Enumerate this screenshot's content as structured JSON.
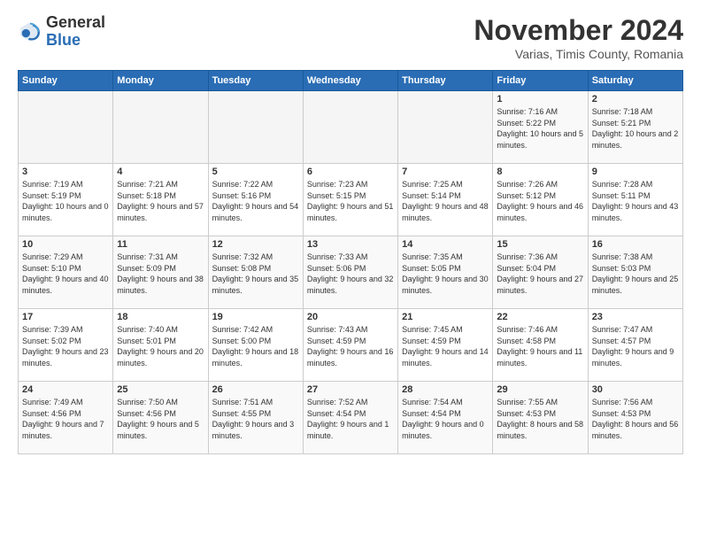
{
  "header": {
    "logo_line1": "General",
    "logo_line2": "Blue",
    "month": "November 2024",
    "location": "Varias, Timis County, Romania"
  },
  "weekdays": [
    "Sunday",
    "Monday",
    "Tuesday",
    "Wednesday",
    "Thursday",
    "Friday",
    "Saturday"
  ],
  "weeks": [
    [
      {
        "day": "",
        "info": ""
      },
      {
        "day": "",
        "info": ""
      },
      {
        "day": "",
        "info": ""
      },
      {
        "day": "",
        "info": ""
      },
      {
        "day": "",
        "info": ""
      },
      {
        "day": "1",
        "info": "Sunrise: 7:16 AM\nSunset: 5:22 PM\nDaylight: 10 hours\nand 5 minutes."
      },
      {
        "day": "2",
        "info": "Sunrise: 7:18 AM\nSunset: 5:21 PM\nDaylight: 10 hours\nand 2 minutes."
      }
    ],
    [
      {
        "day": "3",
        "info": "Sunrise: 7:19 AM\nSunset: 5:19 PM\nDaylight: 10 hours\nand 0 minutes."
      },
      {
        "day": "4",
        "info": "Sunrise: 7:21 AM\nSunset: 5:18 PM\nDaylight: 9 hours\nand 57 minutes."
      },
      {
        "day": "5",
        "info": "Sunrise: 7:22 AM\nSunset: 5:16 PM\nDaylight: 9 hours\nand 54 minutes."
      },
      {
        "day": "6",
        "info": "Sunrise: 7:23 AM\nSunset: 5:15 PM\nDaylight: 9 hours\nand 51 minutes."
      },
      {
        "day": "7",
        "info": "Sunrise: 7:25 AM\nSunset: 5:14 PM\nDaylight: 9 hours\nand 48 minutes."
      },
      {
        "day": "8",
        "info": "Sunrise: 7:26 AM\nSunset: 5:12 PM\nDaylight: 9 hours\nand 46 minutes."
      },
      {
        "day": "9",
        "info": "Sunrise: 7:28 AM\nSunset: 5:11 PM\nDaylight: 9 hours\nand 43 minutes."
      }
    ],
    [
      {
        "day": "10",
        "info": "Sunrise: 7:29 AM\nSunset: 5:10 PM\nDaylight: 9 hours\nand 40 minutes."
      },
      {
        "day": "11",
        "info": "Sunrise: 7:31 AM\nSunset: 5:09 PM\nDaylight: 9 hours\nand 38 minutes."
      },
      {
        "day": "12",
        "info": "Sunrise: 7:32 AM\nSunset: 5:08 PM\nDaylight: 9 hours\nand 35 minutes."
      },
      {
        "day": "13",
        "info": "Sunrise: 7:33 AM\nSunset: 5:06 PM\nDaylight: 9 hours\nand 32 minutes."
      },
      {
        "day": "14",
        "info": "Sunrise: 7:35 AM\nSunset: 5:05 PM\nDaylight: 9 hours\nand 30 minutes."
      },
      {
        "day": "15",
        "info": "Sunrise: 7:36 AM\nSunset: 5:04 PM\nDaylight: 9 hours\nand 27 minutes."
      },
      {
        "day": "16",
        "info": "Sunrise: 7:38 AM\nSunset: 5:03 PM\nDaylight: 9 hours\nand 25 minutes."
      }
    ],
    [
      {
        "day": "17",
        "info": "Sunrise: 7:39 AM\nSunset: 5:02 PM\nDaylight: 9 hours\nand 23 minutes."
      },
      {
        "day": "18",
        "info": "Sunrise: 7:40 AM\nSunset: 5:01 PM\nDaylight: 9 hours\nand 20 minutes."
      },
      {
        "day": "19",
        "info": "Sunrise: 7:42 AM\nSunset: 5:00 PM\nDaylight: 9 hours\nand 18 minutes."
      },
      {
        "day": "20",
        "info": "Sunrise: 7:43 AM\nSunset: 4:59 PM\nDaylight: 9 hours\nand 16 minutes."
      },
      {
        "day": "21",
        "info": "Sunrise: 7:45 AM\nSunset: 4:59 PM\nDaylight: 9 hours\nand 14 minutes."
      },
      {
        "day": "22",
        "info": "Sunrise: 7:46 AM\nSunset: 4:58 PM\nDaylight: 9 hours\nand 11 minutes."
      },
      {
        "day": "23",
        "info": "Sunrise: 7:47 AM\nSunset: 4:57 PM\nDaylight: 9 hours\nand 9 minutes."
      }
    ],
    [
      {
        "day": "24",
        "info": "Sunrise: 7:49 AM\nSunset: 4:56 PM\nDaylight: 9 hours\nand 7 minutes."
      },
      {
        "day": "25",
        "info": "Sunrise: 7:50 AM\nSunset: 4:56 PM\nDaylight: 9 hours\nand 5 minutes."
      },
      {
        "day": "26",
        "info": "Sunrise: 7:51 AM\nSunset: 4:55 PM\nDaylight: 9 hours\nand 3 minutes."
      },
      {
        "day": "27",
        "info": "Sunrise: 7:52 AM\nSunset: 4:54 PM\nDaylight: 9 hours\nand 1 minute."
      },
      {
        "day": "28",
        "info": "Sunrise: 7:54 AM\nSunset: 4:54 PM\nDaylight: 9 hours\nand 0 minutes."
      },
      {
        "day": "29",
        "info": "Sunrise: 7:55 AM\nSunset: 4:53 PM\nDaylight: 8 hours\nand 58 minutes."
      },
      {
        "day": "30",
        "info": "Sunrise: 7:56 AM\nSunset: 4:53 PM\nDaylight: 8 hours\nand 56 minutes."
      }
    ]
  ]
}
